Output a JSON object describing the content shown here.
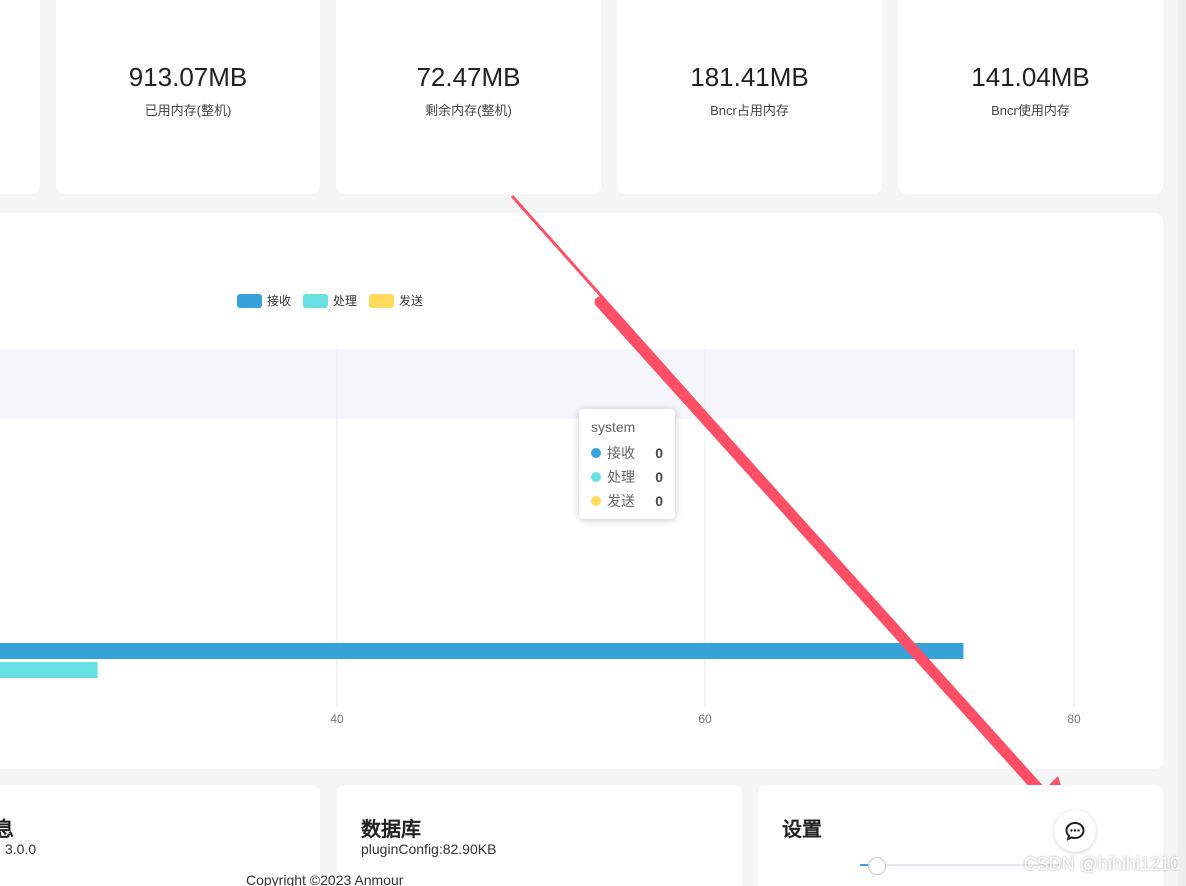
{
  "stats": [
    {
      "value": "913.07MB",
      "label": "已用内存(整机)"
    },
    {
      "value": "72.47MB",
      "label": "剩余内存(整机)"
    },
    {
      "value": "181.41MB",
      "label": "Bncr占用内存"
    },
    {
      "value": "141.04MB",
      "label": "Bncr使用内存"
    }
  ],
  "chart_data": {
    "type": "bar",
    "orientation": "horizontal",
    "legend": [
      "接收",
      "处理",
      "发送"
    ],
    "legend_position": "top",
    "colors": [
      "#37a2da",
      "#67e0e3",
      "#ffdb5c"
    ],
    "x_ticks": [
      "40",
      "60",
      "80"
    ],
    "xlim": [
      0,
      80
    ],
    "grid": true,
    "visible_bars": [
      {
        "series": "接收",
        "value": 74
      },
      {
        "series": "处理",
        "value": 27
      }
    ],
    "tooltip": {
      "title": "system",
      "rows": [
        {
          "name": "接收",
          "value": "0",
          "color": "#37a2da"
        },
        {
          "name": "处理",
          "value": "0",
          "color": "#67e0e3"
        },
        {
          "name": "发送",
          "value": "0",
          "color": "#ffdb5c"
        }
      ]
    }
  },
  "bottom_cards": [
    {
      "title": "息",
      "line": "3.0.0"
    },
    {
      "title": "数据库",
      "line": "pluginConfig:82.90KB"
    },
    {
      "title": "设置",
      "line": ""
    }
  ],
  "footer": {
    "copyright": "Copyright ©2023 Anmour"
  },
  "watermark": "CSDN @hihihi1210",
  "icons": {
    "fab": "chat-icon"
  }
}
